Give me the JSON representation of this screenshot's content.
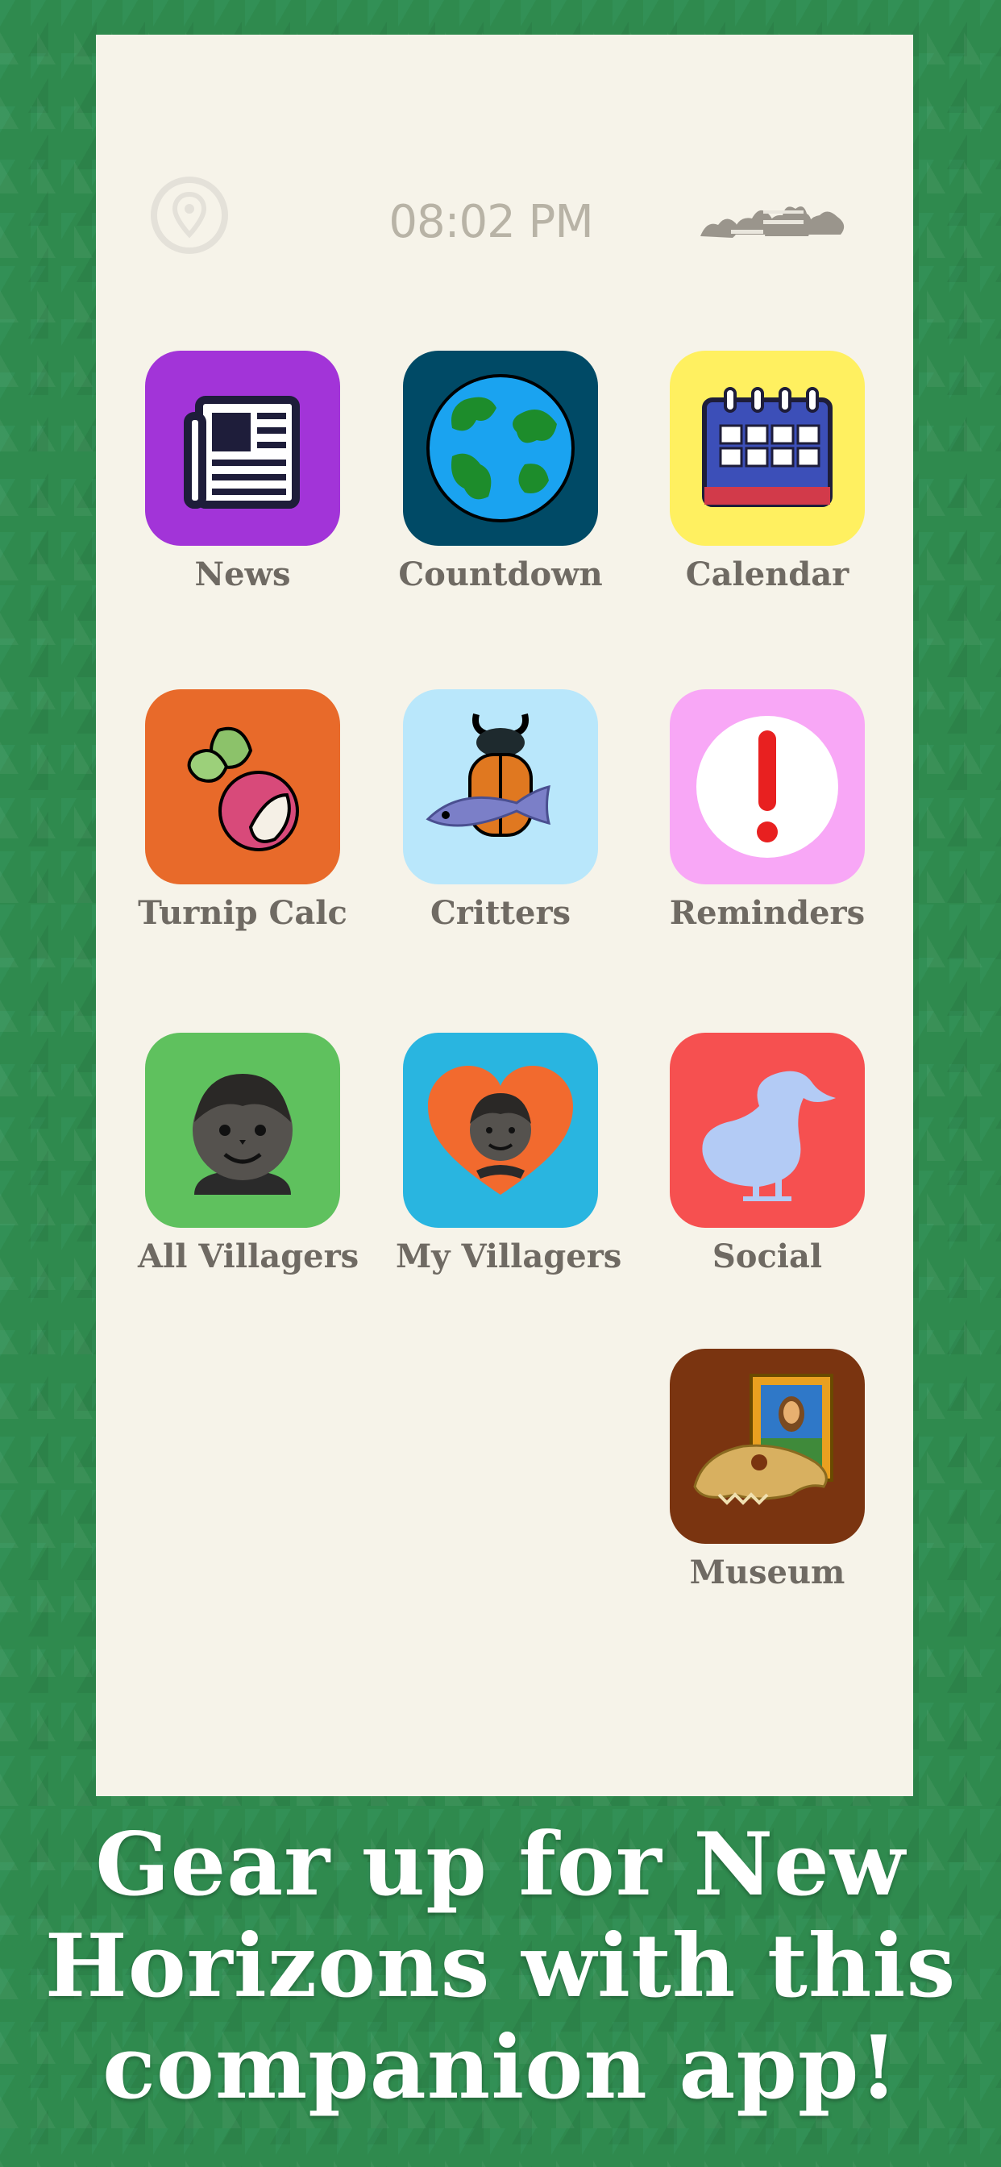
{
  "status": {
    "time": "08:02 PM",
    "location_icon": "map-pin-icon",
    "logo_icon": "island-clouds-logo"
  },
  "apps": [
    {
      "label": "News",
      "icon": "newspaper-icon",
      "color": "#a234d8"
    },
    {
      "label": "Countdown",
      "icon": "globe-icon",
      "color": "#004a66"
    },
    {
      "label": "Calendar",
      "icon": "calendar-icon",
      "color": "#fff060"
    },
    {
      "label": "Turnip Calc",
      "icon": "turnip-icon",
      "color": "#e86a2a"
    },
    {
      "label": "Critters",
      "icon": "bug-fish-icon",
      "color": "#b9e7fb"
    },
    {
      "label": "Reminders",
      "icon": "exclamation-icon",
      "color": "#f8a7f6"
    },
    {
      "label": "All Villagers",
      "icon": "villager-face-icon",
      "color": "#5fc15e"
    },
    {
      "label": "My Villagers",
      "icon": "heart-villager-icon",
      "color": "#29b5e0"
    },
    {
      "label": "Social",
      "icon": "dodo-icon",
      "color": "#f65050"
    },
    {
      "label": "Museum",
      "icon": "museum-fossil-painting-icon",
      "color": "#7a3410"
    }
  ],
  "headline": {
    "line1": "Gear up for New",
    "line2": "Horizons with this",
    "line3": "companion app!"
  }
}
